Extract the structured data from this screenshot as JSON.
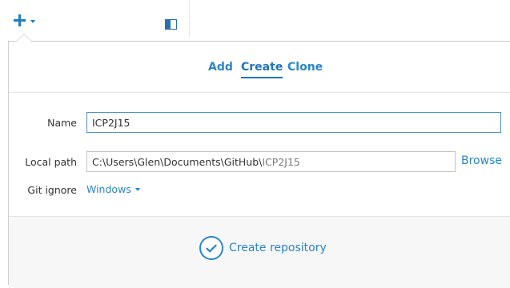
{
  "toolbar": {
    "add_icon": "plus-icon",
    "dropdown_icon": "caret-down-icon",
    "panel_icon": "sidebar-panel-icon"
  },
  "tabs": [
    {
      "label": "Add",
      "active": false
    },
    {
      "label": "Create",
      "active": true
    },
    {
      "label": "Clone",
      "active": false
    }
  ],
  "form": {
    "name_label": "Name",
    "name_value": "ICP2J15",
    "local_path_label": "Local path",
    "local_path_prefix": "C:\\Users\\Glen\\Documents\\GitHub\\",
    "local_path_suffix": "ICP2J15",
    "browse_label": "Browse",
    "git_ignore_label": "Git ignore",
    "git_ignore_value": "Windows"
  },
  "footer": {
    "create_label": "Create repository",
    "create_icon": "check-circle-icon"
  },
  "colors": {
    "accent": "#2a85c9",
    "active_tab": "#1f74b8",
    "text": "#333333",
    "muted": "#7b7b7b"
  }
}
